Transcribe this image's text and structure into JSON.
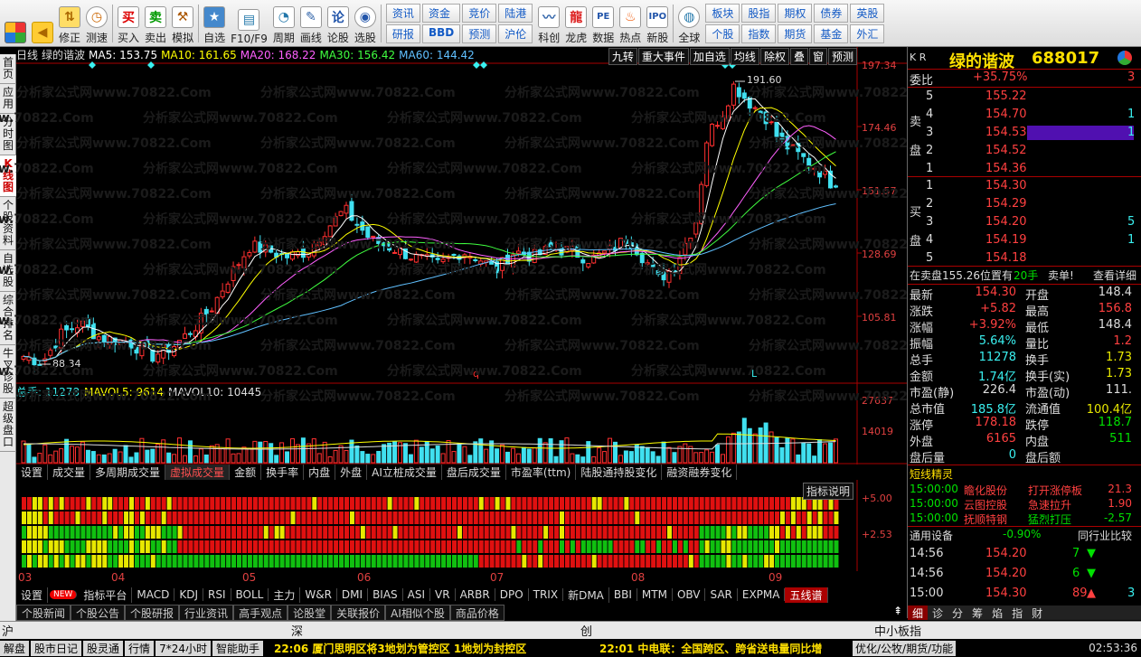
{
  "toolbar": {
    "left": [
      "修正",
      "测速",
      "买入",
      "卖出",
      "模拟",
      "自选",
      "F10/F9",
      "周期",
      "画线",
      "论股",
      "选股"
    ],
    "grid1": [
      "资讯",
      "资金",
      "竞价",
      "陆港",
      "研报",
      "BBD",
      "预测",
      "沪伦"
    ],
    "icons2": [
      "科创",
      "龙虎",
      "数据",
      "热点",
      "新股",
      "全球"
    ],
    "grid2": [
      "板块",
      "股指",
      "期权",
      "债券",
      "英股",
      "个股",
      "指数",
      "期货",
      "基金",
      "外汇"
    ]
  },
  "vtabs": [
    "首页",
    "应用",
    "分时图",
    "K线图",
    "个股资料",
    "自选股",
    "综合排名",
    "牛叉诊股",
    "超级盘口"
  ],
  "header": {
    "period": "日线",
    "stock": "绿的谐波",
    "ma5": "MA5: 153.75",
    "ma10": "MA10: 161.65",
    "ma20": "MA20: 168.22",
    "ma30": "MA30: 156.42",
    "ma60": "MA60: 144.42",
    "buttons": [
      "九转",
      "重大事件",
      "加自选",
      "均线",
      "除权",
      "叠",
      "窗",
      "预测"
    ]
  },
  "price_axis": [
    "197.34",
    "174.46",
    "151.57",
    "128.69",
    "105.81"
  ],
  "annotations": {
    "high": "191.60",
    "low": "88.34",
    "q": "q",
    "L": "L"
  },
  "volume": {
    "total": "总手: 11278",
    "v5": "MAVOL5: 9614",
    "v10": "MAVOL10: 10445",
    "axis": [
      "27637",
      "14019"
    ]
  },
  "ind_tabs": [
    "设置",
    "成交量",
    "多周期成交量",
    "虚拟成交量",
    "金额",
    "换手率",
    "内盘",
    "外盘",
    "AI立桩成交量",
    "盘后成交量",
    "市盈率(ttm)",
    "陆股通持股变化",
    "融资融券变化"
  ],
  "grid_panel": {
    "btn": "指标说明",
    "axis": [
      "+5.00",
      "+2.53"
    ]
  },
  "months": [
    "03",
    "04",
    "05",
    "06",
    "07",
    "08",
    "09"
  ],
  "bottom_tabs": [
    "设置",
    "NEW",
    "指标平台",
    "MACD",
    "KDJ",
    "RSI",
    "BOLL",
    "主力",
    "W&R",
    "DMI",
    "BIAS",
    "ASI",
    "VR",
    "ARBR",
    "DPO",
    "TRIX",
    "新DMA",
    "BBI",
    "MTM",
    "OBV",
    "SAR",
    "EXPMA",
    "五线谱"
  ],
  "news_tabs": [
    "个股新闻",
    "个股公告",
    "个股研报",
    "行业资讯",
    "高手观点",
    "论股堂",
    "关联报价",
    "AI相似个股",
    "商品价格"
  ],
  "rp": {
    "kr": "K R",
    "name": "绿的谐波",
    "code": "688017",
    "weibi_l": "委比",
    "weibi_v": "+35.75%",
    "weibi_n": "3",
    "sell": [
      [
        "5",
        "155.22",
        ""
      ],
      [
        "4",
        "154.70",
        "1"
      ],
      [
        "3",
        "154.53",
        "1"
      ],
      [
        "2",
        "154.52",
        ""
      ],
      [
        "1",
        "154.36",
        ""
      ]
    ],
    "buy": [
      [
        "1",
        "154.30",
        ""
      ],
      [
        "2",
        "154.29",
        ""
      ],
      [
        "3",
        "154.20",
        "5"
      ],
      [
        "4",
        "154.19",
        "1"
      ],
      [
        "5",
        "154.18",
        ""
      ]
    ],
    "sell_lbl": [
      "卖",
      "盘"
    ],
    "buy_lbl": [
      "买",
      "盘"
    ],
    "info": "在卖盘155.26位置有",
    "info_n": "20手",
    "info_b": "卖单!",
    "info_c": "查看详细",
    "stats": [
      [
        "最新",
        "154.30",
        "开盘",
        "148.4"
      ],
      [
        "涨跌",
        "+5.82",
        "最高",
        "156.8"
      ],
      [
        "涨幅",
        "+3.92%",
        "最低",
        "148.4"
      ],
      [
        "振幅",
        "5.64%",
        "量比",
        "1.2"
      ],
      [
        "总手",
        "11278",
        "换手",
        "1.73"
      ],
      [
        "金额",
        "1.74亿",
        "换手(实)",
        "1.73"
      ],
      [
        "市盈(静)",
        "226.4",
        "市盈(动)",
        "111."
      ],
      [
        "总市值",
        "185.8亿",
        "流通值",
        "100.4亿"
      ],
      [
        "涨停",
        "178.18",
        "跌停",
        "118.7"
      ],
      [
        "外盘",
        "6165",
        "内盘",
        "511"
      ],
      [
        "盘后量",
        "0",
        "盘后额",
        ""
      ]
    ],
    "sprite_title": "短线精灵",
    "sprite": [
      [
        "15:00:00",
        "瞻化股份",
        "打开涨停板",
        "21.3"
      ],
      [
        "15:00:00",
        "云图控股",
        "急速拉升",
        "1.90"
      ],
      [
        "15:00:00",
        "抚顺特钢",
        "猛烈打压",
        "-2.57"
      ]
    ],
    "sector": "通用设备",
    "sector_v": "-0.90%",
    "sector_r": "同行业比较",
    "ticks": [
      [
        "14:56",
        "154.20",
        "7"
      ],
      [
        "14:56",
        "154.20",
        "6"
      ],
      [
        "15:00",
        "154.30",
        "89"
      ]
    ],
    "ticks_n": "3",
    "tabs": [
      "细",
      "诊",
      "分",
      "筹",
      "焰",
      "指",
      "财"
    ]
  },
  "idx": {
    "sh": "沪",
    "sz": "深",
    "cy": "创",
    "zx": "中小板指"
  },
  "status": {
    "btns": [
      "解盘",
      "股市日记",
      "股灵通",
      "行情",
      "7*24小时",
      "智能助手"
    ],
    "news1": "22:06 厦门思明区将3地划为管控区 1地划为封控区",
    "news2": "22:01 中电联：全国跨区、跨省送电量同比增",
    "tail": "优化/公牧/期货/功能",
    "clock": "02:53:36"
  }
}
